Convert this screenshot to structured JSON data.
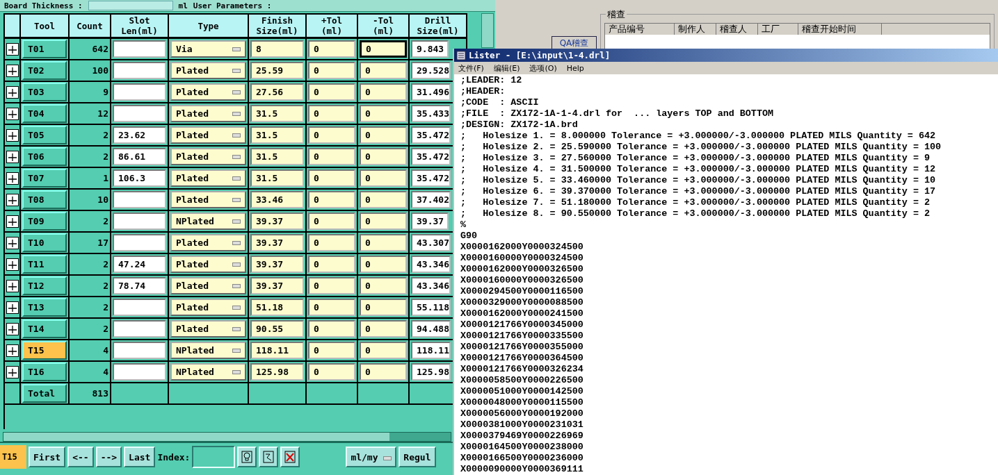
{
  "top_bar": {
    "labels": [
      "Board Thickness :",
      "ml",
      "User Parameters :"
    ]
  },
  "table": {
    "columns": [
      "Tool",
      "Count",
      "Slot\nLen(ml)",
      "Type",
      "Finish\nSize(ml)",
      "+Tol\n(ml)",
      "-Tol\n(ml)",
      "Drill\nSize(ml)"
    ],
    "rows": [
      {
        "tool": "T01",
        "count": "642",
        "slot": "",
        "type": "Via",
        "finish": "8",
        "ptol": "0",
        "ntol": "0",
        "drill": "9.843",
        "selected": false,
        "ntol_focused": true
      },
      {
        "tool": "T02",
        "count": "100",
        "slot": "",
        "type": "Plated",
        "finish": "25.59",
        "ptol": "0",
        "ntol": "0",
        "drill": "29.528",
        "selected": false,
        "ntol_focused": false
      },
      {
        "tool": "T03",
        "count": "9",
        "slot": "",
        "type": "Plated",
        "finish": "27.56",
        "ptol": "0",
        "ntol": "0",
        "drill": "31.496",
        "selected": false,
        "ntol_focused": false
      },
      {
        "tool": "T04",
        "count": "12",
        "slot": "",
        "type": "Plated",
        "finish": "31.5",
        "ptol": "0",
        "ntol": "0",
        "drill": "35.433",
        "selected": false,
        "ntol_focused": false
      },
      {
        "tool": "T05",
        "count": "2",
        "slot": "23.62",
        "type": "Plated",
        "finish": "31.5",
        "ptol": "0",
        "ntol": "0",
        "drill": "35.472",
        "selected": false,
        "ntol_focused": false
      },
      {
        "tool": "T06",
        "count": "2",
        "slot": "86.61",
        "type": "Plated",
        "finish": "31.5",
        "ptol": "0",
        "ntol": "0",
        "drill": "35.472",
        "selected": false,
        "ntol_focused": false
      },
      {
        "tool": "T07",
        "count": "1",
        "slot": "106.3",
        "type": "Plated",
        "finish": "31.5",
        "ptol": "0",
        "ntol": "0",
        "drill": "35.472",
        "selected": false,
        "ntol_focused": false
      },
      {
        "tool": "T08",
        "count": "10",
        "slot": "",
        "type": "Plated",
        "finish": "33.46",
        "ptol": "0",
        "ntol": "0",
        "drill": "37.402",
        "selected": false,
        "ntol_focused": false
      },
      {
        "tool": "T09",
        "count": "2",
        "slot": "",
        "type": "NPlated",
        "finish": "39.37",
        "ptol": "0",
        "ntol": "0",
        "drill": "39.37",
        "selected": false,
        "ntol_focused": false
      },
      {
        "tool": "T10",
        "count": "17",
        "slot": "",
        "type": "Plated",
        "finish": "39.37",
        "ptol": "0",
        "ntol": "0",
        "drill": "43.307",
        "selected": false,
        "ntol_focused": false
      },
      {
        "tool": "T11",
        "count": "2",
        "slot": "47.24",
        "type": "Plated",
        "finish": "39.37",
        "ptol": "0",
        "ntol": "0",
        "drill": "43.346",
        "selected": false,
        "ntol_focused": false
      },
      {
        "tool": "T12",
        "count": "2",
        "slot": "78.74",
        "type": "Plated",
        "finish": "39.37",
        "ptol": "0",
        "ntol": "0",
        "drill": "43.346",
        "selected": false,
        "ntol_focused": false
      },
      {
        "tool": "T13",
        "count": "2",
        "slot": "",
        "type": "Plated",
        "finish": "51.18",
        "ptol": "0",
        "ntol": "0",
        "drill": "55.118",
        "selected": false,
        "ntol_focused": false
      },
      {
        "tool": "T14",
        "count": "2",
        "slot": "",
        "type": "Plated",
        "finish": "90.55",
        "ptol": "0",
        "ntol": "0",
        "drill": "94.488",
        "selected": false,
        "ntol_focused": false
      },
      {
        "tool": "T15",
        "count": "4",
        "slot": "",
        "type": "NPlated",
        "finish": "118.11",
        "ptol": "0",
        "ntol": "0",
        "drill": "118.11",
        "selected": true,
        "ntol_focused": false
      },
      {
        "tool": "T16",
        "count": "4",
        "slot": "",
        "type": "NPlated",
        "finish": "125.98",
        "ptol": "0",
        "ntol": "0",
        "drill": "125.98",
        "selected": false,
        "ntol_focused": false
      }
    ],
    "total": {
      "label": "Total",
      "count": "813"
    }
  },
  "toolbar": {
    "current_tool": "T15",
    "buttons": [
      "First",
      "<--",
      "-->",
      "Last"
    ],
    "index_label": "Index:",
    "unit_select": "ml/my",
    "trailing_button": "Regul"
  },
  "audit_window": {
    "qa_button": "QA稽查",
    "group_title": "稽查",
    "columns": [
      "产品编号",
      "制作人",
      "稽查人",
      "工厂",
      "稽查开始时间"
    ]
  },
  "lister": {
    "title": "Lister - [E:\\input\\1-4.drl]",
    "menu": [
      "文件(F)",
      "编辑(E)",
      "选项(O)",
      "Help"
    ],
    "lines": [
      ";LEADER: 12",
      ";HEADER:",
      ";CODE  : ASCII",
      ";FILE  : ZX172-1A-1-4.drl for  ... layers TOP and BOTTOM",
      ";DESIGN: ZX172-1A.brd",
      ";   Holesize 1. = 8.000000 Tolerance = +3.000000/-3.000000 PLATED MILS Quantity = 642",
      ";   Holesize 2. = 25.590000 Tolerance = +3.000000/-3.000000 PLATED MILS Quantity = 100",
      ";   Holesize 3. = 27.560000 Tolerance = +3.000000/-3.000000 PLATED MILS Quantity = 9",
      ";   Holesize 4. = 31.500000 Tolerance = +3.000000/-3.000000 PLATED MILS Quantity = 12",
      ";   Holesize 5. = 33.460000 Tolerance = +3.000000/-3.000000 PLATED MILS Quantity = 10",
      ";   Holesize 6. = 39.370000 Tolerance = +3.000000/-3.000000 PLATED MILS Quantity = 17",
      ";   Holesize 7. = 51.180000 Tolerance = +3.000000/-3.000000 PLATED MILS Quantity = 2",
      ";   Holesize 8. = 90.550000 Tolerance = +3.000000/-3.000000 PLATED MILS Quantity = 2",
      "%",
      "G90",
      "X0000162000Y0000324500",
      "X0000160000Y0000324500",
      "X0000162000Y0000326500",
      "X0000160000Y0000326500",
      "X0000294500Y0000116500",
      "X0000329000Y0000088500",
      "X0000162000Y0000241500",
      "X0000121766Y0000345000",
      "X0000121766Y0000335500",
      "X0000121766Y0000355000",
      "X0000121766Y0000364500",
      "X0000121766Y0000326234",
      "X0000058500Y0000226500",
      "X0000051000Y0000142500",
      "X0000048000Y0000115500",
      "X0000056000Y0000192000",
      "X0000381000Y0000231031",
      "X0000379469Y0000226969",
      "X0000164500Y0000238000",
      "X0000166500Y0000236000",
      "X0000090000Y0000369111"
    ]
  }
}
